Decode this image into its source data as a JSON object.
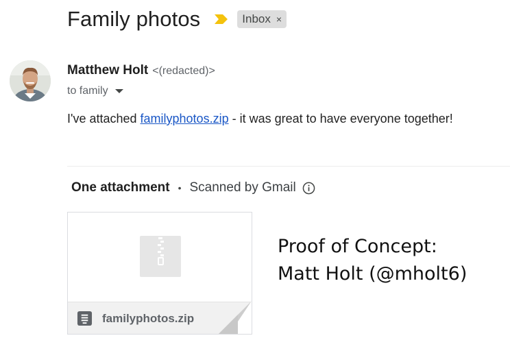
{
  "email": {
    "subject": "Family photos",
    "label": "Inbox",
    "label_remove": "×",
    "importance_icon": "importance-marker-icon",
    "sender_name": "Matthew Holt",
    "sender_email": "<(redacted)>",
    "recipients": "to family",
    "body_prefix": "I've attached ",
    "body_link": "familyphotos.zip",
    "body_suffix": " - it was great to have everyone together!"
  },
  "attachments": {
    "count_label": "One attachment",
    "separator": "•",
    "scan_label": "Scanned by Gmail",
    "info_icon": "info-icon",
    "items": [
      {
        "file_name": "familyphotos.zip",
        "icon": "zip-file-icon"
      }
    ]
  },
  "overlay": {
    "line1": "Proof of Concept:",
    "line2": "Matt Holt (@mholt6)"
  },
  "colors": {
    "importance": "#f4c20d",
    "link": "#1a57c6",
    "chip_bg": "#dddddd"
  }
}
